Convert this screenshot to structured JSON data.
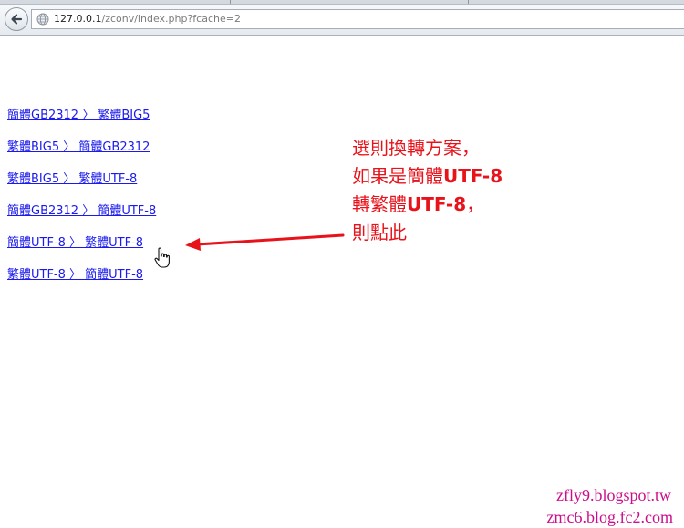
{
  "browser": {
    "url_host": "127.0.0.1",
    "url_path": "/zconv/index.php?fcache=2"
  },
  "links": [
    {
      "label": "簡體GB2312 〉 繁體BIG5"
    },
    {
      "label": "繁體BIG5 〉 簡體GB2312"
    },
    {
      "label": "繁體BIG5 〉 繁體UTF-8"
    },
    {
      "label": "簡體GB2312 〉 簡體UTF-8"
    },
    {
      "label": "簡體UTF-8 〉 繁體UTF-8"
    },
    {
      "label": "繁體UTF-8 〉 簡體UTF-8"
    }
  ],
  "annotation": {
    "line1": "選則換轉方案，",
    "line2_text": "如果是簡體",
    "line2_bold": "UTF-8",
    "line3_text": "轉繁體",
    "line3_bold": "UTF-8",
    "line3_tail": "，",
    "line4": "則點此",
    "color": "#e8121a"
  },
  "watermark": {
    "line1": "zfly9.blogspot.tw",
    "line2": "zmc6.blog.fc2.com",
    "color": "#cc0e8c"
  },
  "icons": {
    "back": "back-arrow-icon",
    "site": "globe-icon",
    "cursor": "hand-cursor-icon"
  }
}
